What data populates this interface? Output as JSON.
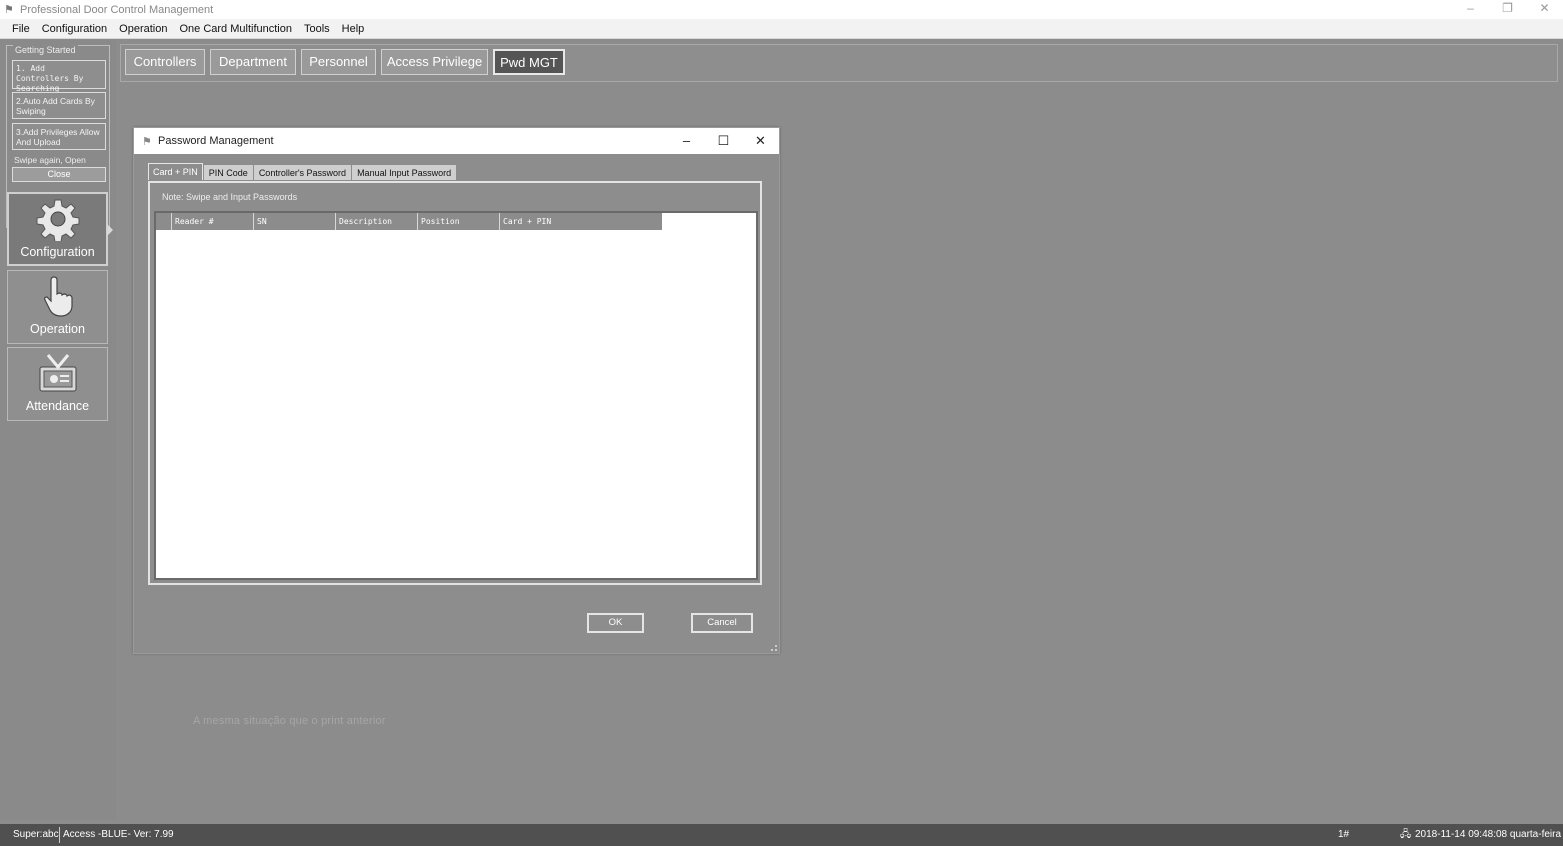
{
  "window": {
    "title": "Professional Door Control Management",
    "icon": "app-logo-icon",
    "controls": [
      "minimize",
      "restore",
      "close"
    ]
  },
  "menu": [
    "File",
    "Configuration",
    "Operation",
    "One Card Multifunction",
    "Tools",
    "Help"
  ],
  "sidebar": {
    "getting_started": {
      "legend": "Getting Started",
      "step1": "1. Add Controllers By Searching",
      "step2": "2.Auto Add Cards By Swiping",
      "step3": "3.Add Privileges Allow And Upload",
      "hint": "Swipe again, Open",
      "close": "Close"
    },
    "nav": [
      {
        "label": "Configuration",
        "icon": "gear-icon",
        "active": true
      },
      {
        "label": "Operation",
        "icon": "hand-pointer-icon",
        "active": false
      },
      {
        "label": "Attendance",
        "icon": "attendance-icon",
        "active": false
      }
    ]
  },
  "toolbar": {
    "buttons": [
      "Controllers",
      "Department",
      "Personnel",
      "Access Privilege",
      "Pwd MGT"
    ],
    "active": "Pwd MGT"
  },
  "overlay_text": "A mesma situação que o print anterior",
  "dialog": {
    "title": "Password Management",
    "tabs": [
      "Card + PIN",
      "PIN Code",
      "Controller's Password",
      "Manual Input Password"
    ],
    "active_tab": "Card + PIN",
    "note": "Note:  Swipe and Input Passwords",
    "columns": [
      "Reader #",
      "SN",
      "Description",
      "Position",
      "Card + PIN"
    ],
    "rows": [],
    "ok": "OK",
    "cancel": "Cancel"
  },
  "status": {
    "user": "Super:abc",
    "version": "Access -BLUE- Ver: 7.99",
    "index": "1#",
    "datetime": "2018-11-14 09:48:08 quarta-feira"
  },
  "colors": {
    "background": "#8c8c8c",
    "statusbar": "#505050",
    "active_toolbar": "#555555"
  }
}
